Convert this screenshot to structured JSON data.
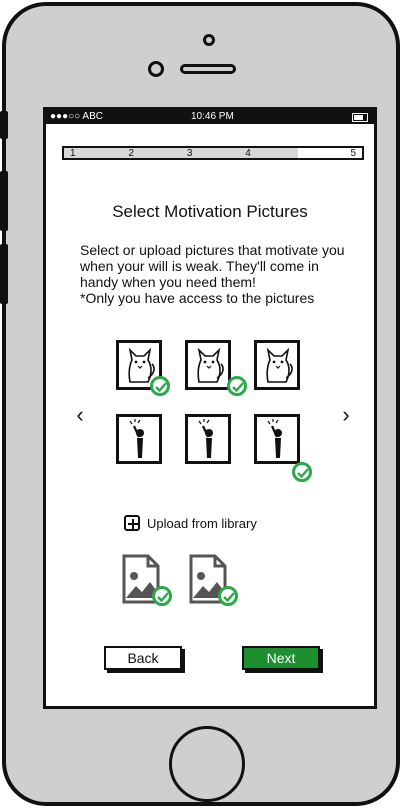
{
  "status_bar": {
    "carrier": "●●●○○ ABC",
    "time": "10:46 PM",
    "battery_icon": "battery-icon"
  },
  "progress": {
    "steps": [
      "1",
      "2",
      "3",
      "4",
      "5"
    ],
    "current_step": 5
  },
  "title": "Select Motivation Pictures",
  "description": {
    "line1": "Select or upload pictures that motivate you when your will is weak. They'll come in handy when you need them!",
    "line2": "*Only you have access to the pictures"
  },
  "nav": {
    "prev_icon": "chevron-left-icon",
    "next_icon": "chevron-right-icon",
    "prev": "‹",
    "next": "›"
  },
  "pictures": [
    {
      "icon": "cat-picture-icon",
      "selected": true
    },
    {
      "icon": "cat-picture-icon",
      "selected": true
    },
    {
      "icon": "cat-picture-icon",
      "selected": false
    },
    {
      "icon": "person-picture-icon",
      "selected": false
    },
    {
      "icon": "person-picture-icon",
      "selected": false
    },
    {
      "icon": "person-picture-icon",
      "selected": true
    }
  ],
  "upload": {
    "label": "Upload from library",
    "icon": "plus-square-icon"
  },
  "uploaded_files": [
    {
      "icon": "image-file-icon",
      "selected": true
    },
    {
      "icon": "image-file-icon",
      "selected": true
    }
  ],
  "buttons": {
    "back": "Back",
    "next": "Next"
  },
  "colors": {
    "accent_green": "#1e8f2e",
    "check_green": "#2aa84a",
    "phone_gray": "#cfcfcf"
  }
}
